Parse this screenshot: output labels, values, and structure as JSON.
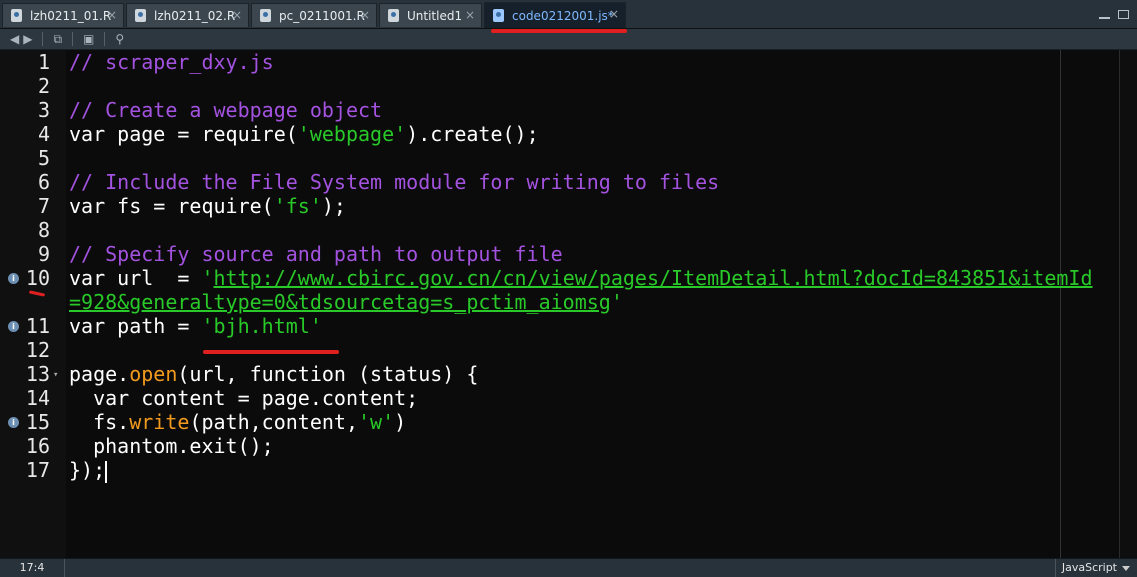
{
  "tabs": [
    {
      "label": "lzh0211_01.R",
      "active": false
    },
    {
      "label": "lzh0211_02.R",
      "active": false
    },
    {
      "label": "pc_0211001.R",
      "active": false
    },
    {
      "label": "Untitled1",
      "active": false
    },
    {
      "label": "code0212001.js*",
      "active": true
    }
  ],
  "tab_close_glyph": "×",
  "toolbar": {
    "back_icon": "arrow-left-icon",
    "forward_icon": "arrow-right-icon",
    "show_in_window_icon": "popout-icon",
    "save_icon": "save-icon",
    "search_icon": "search-icon"
  },
  "code_lines": [
    {
      "n": "1"
    },
    {
      "n": "2"
    },
    {
      "n": "3"
    },
    {
      "n": "4"
    },
    {
      "n": "5"
    },
    {
      "n": "6"
    },
    {
      "n": "7"
    },
    {
      "n": "8"
    },
    {
      "n": "9"
    },
    {
      "n": "10"
    },
    {
      "n": "",
      "continuation": true
    },
    {
      "n": "11"
    },
    {
      "n": "12"
    },
    {
      "n": "13"
    },
    {
      "n": "14"
    },
    {
      "n": "15"
    },
    {
      "n": "16"
    },
    {
      "n": "17"
    }
  ],
  "code": {
    "l1": "// scraper_dxy.js",
    "l3": "// Create a webpage object",
    "l4a": "var page = require(",
    "l4b": "'webpage'",
    "l4c": ").create();",
    "l6": "// Include the File System module for writing to files",
    "l7a": "var fs = require(",
    "l7b": "'fs'",
    "l7c": ");",
    "l9": "// Specify source and path to output file",
    "l10a": "var url  = ",
    "l10b": "'",
    "l10c": "http://www.cbirc.gov.cn/cn/view/pages/ItemDetail.html?docId=843851&itemId",
    "l10d": "=928&generaltype=0&tdsourcetag=s_pctim_aiomsg",
    "l10e": "'",
    "l11a": "var path = ",
    "l11b": "'bjh.html'",
    "l13a": "page.",
    "l13b": "open",
    "l13c": "(url, function (status) {",
    "l14": "  var content = page.content;",
    "l15a": "  fs.",
    "l15b": "write",
    "l15c": "(path,content,",
    "l15d": "'w'",
    "l15e": ")",
    "l16": "  phantom.exit();",
    "l17": "});"
  },
  "info_marker": "i",
  "fold_marker": "▾",
  "status": {
    "cursor_pos": "17:4",
    "language": "JavaScript"
  },
  "colors": {
    "comment": "#a452e0",
    "string": "#28c928",
    "function": "#f29a1d",
    "annotation": "#e02020"
  }
}
